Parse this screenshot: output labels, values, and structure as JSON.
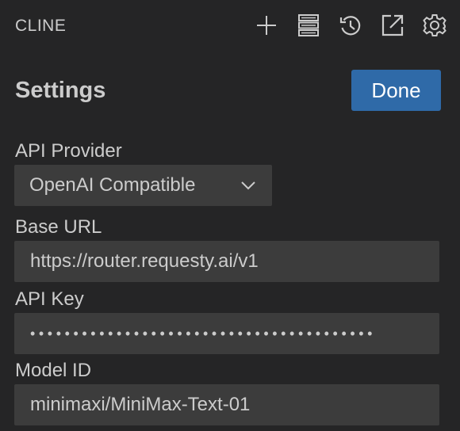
{
  "header": {
    "title": "CLINE",
    "toolbar": [
      {
        "icon": "plus-icon",
        "label": "New Task"
      },
      {
        "icon": "server-icon",
        "label": "MCP Servers"
      },
      {
        "icon": "history-icon",
        "label": "History"
      },
      {
        "icon": "popout-icon",
        "label": "Open in Editor"
      },
      {
        "icon": "gear-icon",
        "label": "Settings"
      }
    ]
  },
  "settings": {
    "title": "Settings",
    "done_label": "Done",
    "api_provider": {
      "label": "API Provider",
      "selected": "OpenAI Compatible"
    },
    "base_url": {
      "label": "Base URL",
      "value": "https://router.requesty.ai/v1"
    },
    "api_key": {
      "label": "API Key",
      "value": "••••••••••••••••••••••••••••••••••••••••"
    },
    "model_id": {
      "label": "Model ID",
      "value": "minimaxi/MiniMax-Text-01"
    }
  },
  "colors": {
    "background": "#252526",
    "input_background": "#3c3c3c",
    "text": "#cccccc",
    "button_primary": "#2f6aa8"
  }
}
